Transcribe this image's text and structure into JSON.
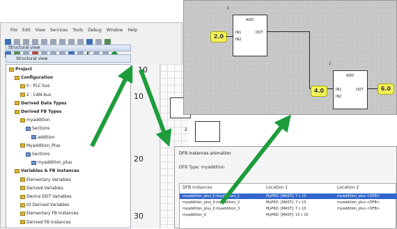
{
  "menu": [
    "File",
    "Edit",
    "View",
    "Services",
    "Tools",
    "Debug",
    "Window",
    "Help"
  ],
  "tree": {
    "title": "Structural view",
    "header": "Structural view",
    "items": [
      {
        "label": "Project",
        "bold": true,
        "indent": 0
      },
      {
        "label": "Configuration",
        "bold": true,
        "indent": 1
      },
      {
        "label": "0 : PLC bus",
        "bold": false,
        "indent": 2
      },
      {
        "label": "2 : CAN bus",
        "bold": false,
        "indent": 2
      },
      {
        "label": "Derived Data Types",
        "bold": true,
        "indent": 1
      },
      {
        "label": "Derived FB Types",
        "bold": true,
        "indent": 1
      },
      {
        "label": "myaddition",
        "bold": false,
        "indent": 2
      },
      {
        "label": "Sections",
        "bold": false,
        "indent": 3
      },
      {
        "label": "addition",
        "bold": false,
        "indent": 4
      },
      {
        "label": "Myaddition_Plus",
        "bold": false,
        "indent": 2
      },
      {
        "label": "Sections",
        "bold": false,
        "indent": 3
      },
      {
        "label": "myaddition_plus",
        "bold": false,
        "indent": 4
      },
      {
        "label": "Variables & FB instances",
        "bold": true,
        "indent": 1
      },
      {
        "label": "Elementary Variables",
        "bold": false,
        "indent": 2
      },
      {
        "label": "Derived Variables",
        "bold": false,
        "indent": 2
      },
      {
        "label": "Device DDT Variables",
        "bold": false,
        "indent": 2
      },
      {
        "label": "IO Derived Variables",
        "bold": false,
        "indent": 2
      },
      {
        "label": "Elementary FB Instances",
        "bold": false,
        "indent": 2
      },
      {
        "label": "Derived FB Instances",
        "bold": false,
        "indent": 2
      }
    ]
  },
  "ruler": [
    "10",
    "10",
    "20",
    "30"
  ],
  "canvas": {
    "block1": {
      "name": "ADD",
      "out": "OUT",
      "in1": "IN1",
      "in2": "IN2",
      "num": "1"
    },
    "block2": {
      "name": "ADD",
      "out": "OUT",
      "in1": "IN1",
      "in2": "IN2",
      "num": "2"
    },
    "var_top": "2.0",
    "var_mid": "4.0",
    "var_out": "6.0"
  },
  "lowdiag": {
    "num": "2"
  },
  "dialog": {
    "title": "DFB instances animation",
    "type_label": "DFB Type: myaddition",
    "columns": [
      "DFB instances",
      "Location 1",
      "Location 2"
    ],
    "rows": [
      {
        "c1": "myaddition_plus_0.myaddition_1",
        "c2": "MyPRD: [MAST]: 7 c 10",
        "c3": "myaddition_plus <DFB>",
        "selected": true
      },
      {
        "c1": "myaddition_plus_0.myaddition_2",
        "c2": "MyPRD: [MAST]: 7 c 10",
        "c3": "myaddition_plus <DFB>",
        "selected": false
      },
      {
        "c1": "myaddition_plus_0.myaddition_3",
        "c2": "MyPRD: [MAST]: 7 c 10",
        "c3": "myaddition_plus <DFB>",
        "selected": false
      },
      {
        "c1": "myaddition_0",
        "c2": "MyPRD: [MAST]: 15 c 15",
        "c3": "",
        "selected": false
      }
    ]
  },
  "colors": {
    "arrow": "#1e9c3c",
    "selection": "#3366cc",
    "var_fill": "#f2f25a"
  }
}
